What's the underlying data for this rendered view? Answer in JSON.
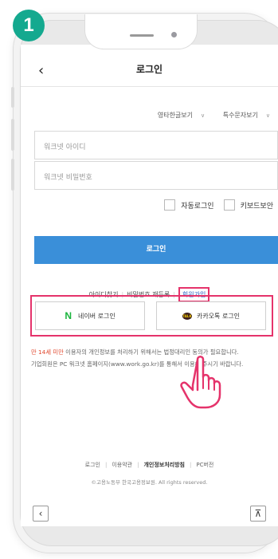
{
  "step_number": "1",
  "header": {
    "back_icon": "‹",
    "title": "로그인"
  },
  "options": {
    "english_view": "영타한글보기",
    "special_char_view": "특수문자보기"
  },
  "inputs": {
    "id_placeholder": "워크넷 아이디",
    "password_placeholder": "워크넷 비밀번호"
  },
  "checks": {
    "auto_login": "자동로그인",
    "keyboard_security": "키보드보안"
  },
  "login_button": "로그인",
  "links": {
    "find_id": "아이디찾기",
    "reissue_password": "비밀번호 재등록",
    "sign_up": "회원가입"
  },
  "social": {
    "naver_icon": "N",
    "naver_label": "네이버 로그인",
    "kakao_icon": "TALK",
    "kakao_label": "카카오톡 로그인"
  },
  "notice": {
    "age_highlight": "만 14세 미만",
    "line1_rest": " 이용자의 개인정보를 처리하기 위해서는 법정대리인 동의가 필요합니다.",
    "line2": "기업회원은 PC 워크넷 홈페이지(www.work.go.kr)를 통해서 이용해 주시기 바랍니다."
  },
  "footer": {
    "login": "로그인",
    "terms": "이용약관",
    "privacy": "개인정보처리방침",
    "pc_version": "PC버전",
    "copyright": "©고용노동부 한국고용정보원. All rights reserved."
  },
  "nav": {
    "prev_icon": "‹",
    "top_icon": "⊼"
  },
  "colors": {
    "step_badge": "#14a98f",
    "login_button": "#3a8fd9",
    "highlight_frame": "#e5336b",
    "naver_green": "#19b43c",
    "notice_red": "#e0472d"
  }
}
